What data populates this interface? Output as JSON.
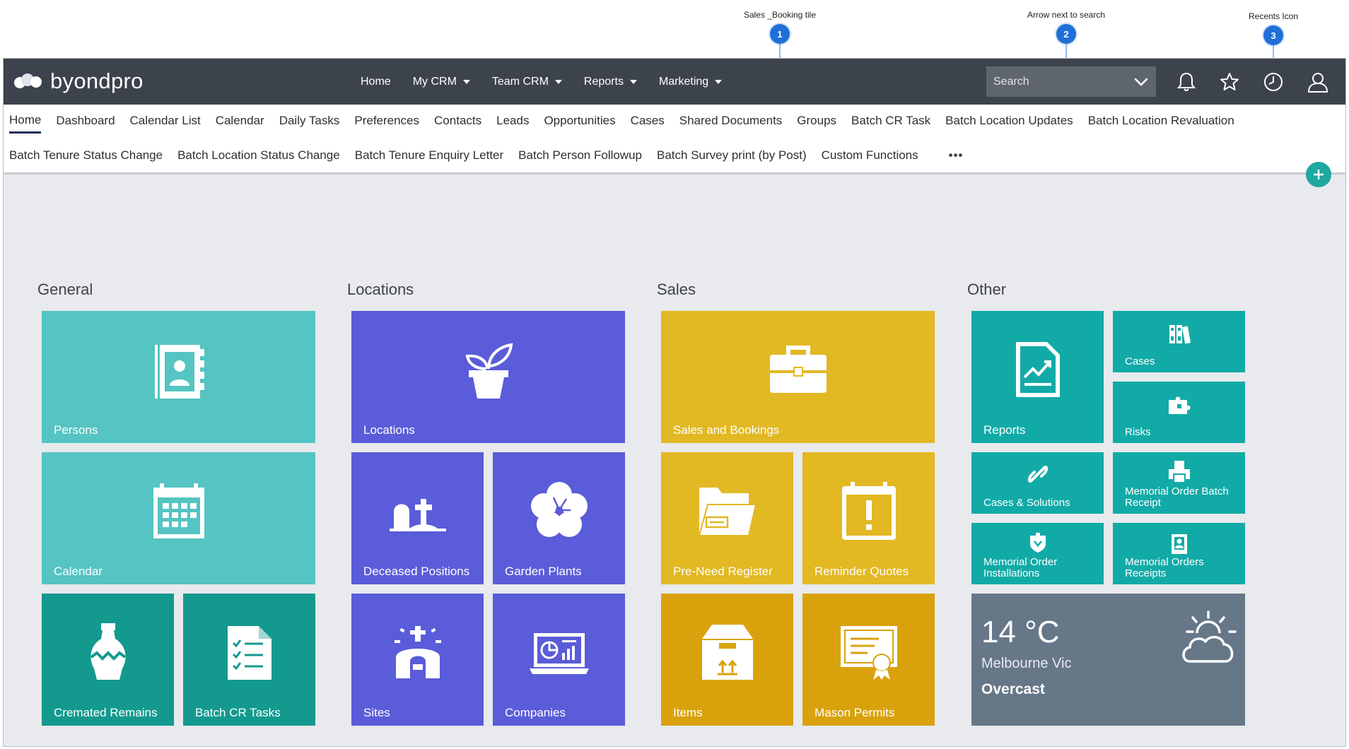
{
  "callouts": [
    {
      "number": "1",
      "label": "Sales _Booking tile"
    },
    {
      "number": "2",
      "label": "Arrow next to search"
    },
    {
      "number": "3",
      "label": "Recents Icon"
    }
  ],
  "app": {
    "logo_text": "byondpro"
  },
  "topnav": [
    {
      "label": "Home",
      "dropdown": false
    },
    {
      "label": "My CRM",
      "dropdown": true
    },
    {
      "label": "Team CRM",
      "dropdown": true
    },
    {
      "label": "Reports",
      "dropdown": true
    },
    {
      "label": "Marketing",
      "dropdown": true
    }
  ],
  "search": {
    "placeholder": "Search"
  },
  "top_icons": [
    "bell-icon",
    "star-icon",
    "clock-icon",
    "user-icon"
  ],
  "subnav": {
    "row1": [
      "Home",
      "Dashboard",
      "Calendar List",
      "Calendar",
      "Daily Tasks",
      "Preferences",
      "Contacts",
      "Leads",
      "Opportunities",
      "Cases",
      "Shared Documents",
      "Groups",
      "Batch CR Task",
      "Batch Location Updates",
      "Batch Location Revaluation"
    ],
    "row2": [
      "Batch Tenure Status Change",
      "Batch Location Status Change",
      "Batch Tenure Enquiry Letter",
      "Batch Person Followup",
      "Batch Survey print (by Post)",
      "Custom Functions"
    ],
    "more": "•••",
    "active": "Home"
  },
  "groups": {
    "general": {
      "title": "General",
      "tiles": [
        "Persons",
        "Calendar",
        "Cremated Remains",
        "Batch CR Tasks"
      ]
    },
    "locations": {
      "title": "Locations",
      "tiles": [
        "Locations",
        "Deceased Positions",
        "Garden Plants",
        "Sites",
        "Companies"
      ]
    },
    "sales": {
      "title": "Sales",
      "tiles": [
        "Sales and Bookings",
        "Pre-Need Register",
        "Reminder Quotes",
        "Items",
        "Mason Permits"
      ]
    },
    "other": {
      "title": "Other",
      "tiles": [
        "Reports",
        "Cases",
        "Risks",
        "Cases & Solutions",
        "Memorial Order Batch Receipt",
        "Memorial Order Installations",
        "Memorial Orders Receipts"
      ]
    }
  },
  "weather": {
    "temperature": "14 °C",
    "city": "Melbourne Vic",
    "condition": "Overcast"
  },
  "colors": {
    "topbar": "#3d434d",
    "teal_light": "#55c4c2",
    "teal_dark": "#14998f",
    "purple": "#5a5cd9",
    "gold": "#e2b823",
    "gold_dark": "#d9a20d",
    "teal_other": "#12aaa7",
    "weather": "#667788",
    "callout": "#1f6fd6"
  }
}
